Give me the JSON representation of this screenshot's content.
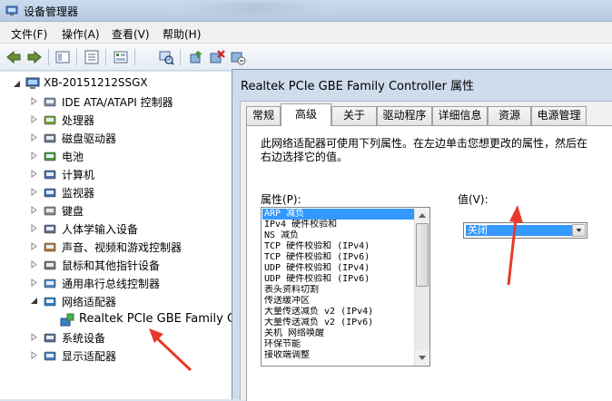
{
  "window": {
    "title": "设备管理器"
  },
  "menu": [
    "文件(F)",
    "操作(A)",
    "查看(V)",
    "帮助(H)"
  ],
  "toolbar": [
    "back-icon",
    "forward-icon",
    "properties-view-icon",
    "help-icon",
    "grid-view-icon",
    "scan-hardware-icon",
    "update-driver-icon",
    "uninstall-icon",
    "disable-device-icon"
  ],
  "tree": {
    "root": "XB-20151212SSGX",
    "categories": [
      {
        "label": "IDE ATA/ATAPI 控制器",
        "icon": "ide-controller-icon"
      },
      {
        "label": "处理器",
        "icon": "processor-icon"
      },
      {
        "label": "磁盘驱动器",
        "icon": "disk-drive-icon"
      },
      {
        "label": "电池",
        "icon": "battery-icon"
      },
      {
        "label": "计算机",
        "icon": "computer-icon"
      },
      {
        "label": "监视器",
        "icon": "monitor-icon"
      },
      {
        "label": "键盘",
        "icon": "keyboard-icon"
      },
      {
        "label": "人体学输入设备",
        "icon": "hid-icon"
      },
      {
        "label": "声音、视频和游戏控制器",
        "icon": "sound-icon"
      },
      {
        "label": "鼠标和其他指针设备",
        "icon": "mouse-icon"
      },
      {
        "label": "通用串行总线控制器",
        "icon": "usb-icon"
      },
      {
        "label": "网络适配器",
        "icon": "network-adapter-icon",
        "expanded": true
      },
      {
        "label": "系统设备",
        "icon": "system-device-icon"
      },
      {
        "label": "显示适配器",
        "icon": "display-adapter-icon"
      }
    ],
    "child": "Realtek PCIe GBE Family Controller"
  },
  "dialog": {
    "title": "Realtek PCIe GBE Family Controller 属性",
    "tabs": [
      "常规",
      "高级",
      "关于",
      "驱动程序",
      "详细信息",
      "资源",
      "电源管理"
    ],
    "active_tab": "高级",
    "description": "此网络适配器可使用下列属性。在左边单击您想更改的属性，然后在右边选择它的值。",
    "property_label": "属性(P):",
    "value_label": "值(V):",
    "properties": [
      "ARP 减负",
      "IPv4 硬件校验和",
      "NS 减负",
      "TCP 硬件校验和 (IPv4)",
      "TCP 硬件校验和 (IPv6)",
      "UDP 硬件校验和 (IPv4)",
      "UDP 硬件校验和 (IPv6)",
      "表头资料切割",
      "传送缓冲区",
      "大量传送减负 v2 (IPv4)",
      "大量传送减负 v2 (IPv6)",
      "关机 网络唤醒",
      "环保节能",
      "接收端调整"
    ],
    "selected_property": "ARP 减负",
    "value": "关闭"
  },
  "colors": {
    "selection": "#3399ff",
    "annotation_arrow": "#e8392b",
    "titlebar": "#c3d6ec"
  }
}
